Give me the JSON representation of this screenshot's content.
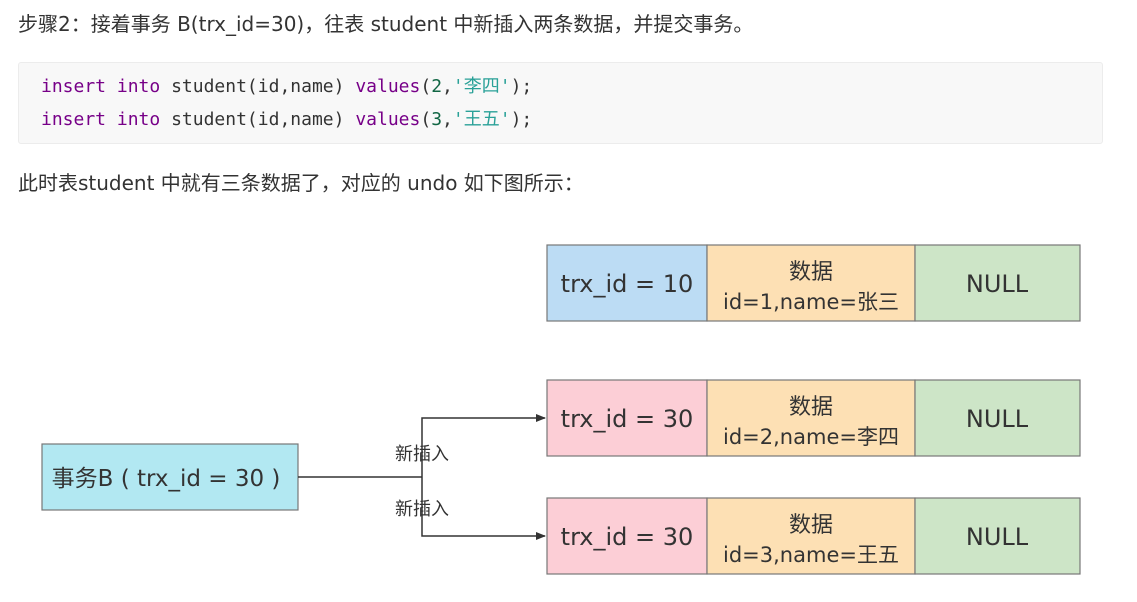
{
  "paragraph1": "步骤2：接着事务 B(trx_id=30)，往表 student 中新插入两条数据，并提交事务。",
  "code": {
    "lines": [
      {
        "kw1": "insert",
        "kw2": "into",
        "table": "student(id,name)",
        "kw3": "values",
        "open": "(",
        "num": "2",
        "comma": ",",
        "str": "'李四'",
        "close": ");"
      },
      {
        "kw1": "insert",
        "kw2": "into",
        "table": "student(id,name)",
        "kw3": "values",
        "open": "(",
        "num": "3",
        "comma": ",",
        "str": "'王五'",
        "close": ");"
      }
    ]
  },
  "paragraph2": "此时表student 中就有三条数据了，对应的 undo 如下图所示：",
  "diagram": {
    "colors": {
      "blue": "#bcdcf4",
      "pink": "#fcced6",
      "orange": "#fde0b4",
      "green": "#cde5c7",
      "cyan": "#b2e8f2",
      "border": "#777777",
      "arrow": "#333333"
    },
    "transaction": "事务B ( trx_id = 30 )",
    "insert_label_top": "新插入",
    "insert_label_bottom": "新插入",
    "records": [
      {
        "trx": "trx_id = 10",
        "data_title": "数据",
        "data_value": "id=1,name=张三",
        "pointer": "NULL"
      },
      {
        "trx": "trx_id = 30",
        "data_title": "数据",
        "data_value": "id=2,name=李四",
        "pointer": "NULL"
      },
      {
        "trx": "trx_id = 30",
        "data_title": "数据",
        "data_value": "id=3,name=王五",
        "pointer": "NULL"
      }
    ]
  }
}
